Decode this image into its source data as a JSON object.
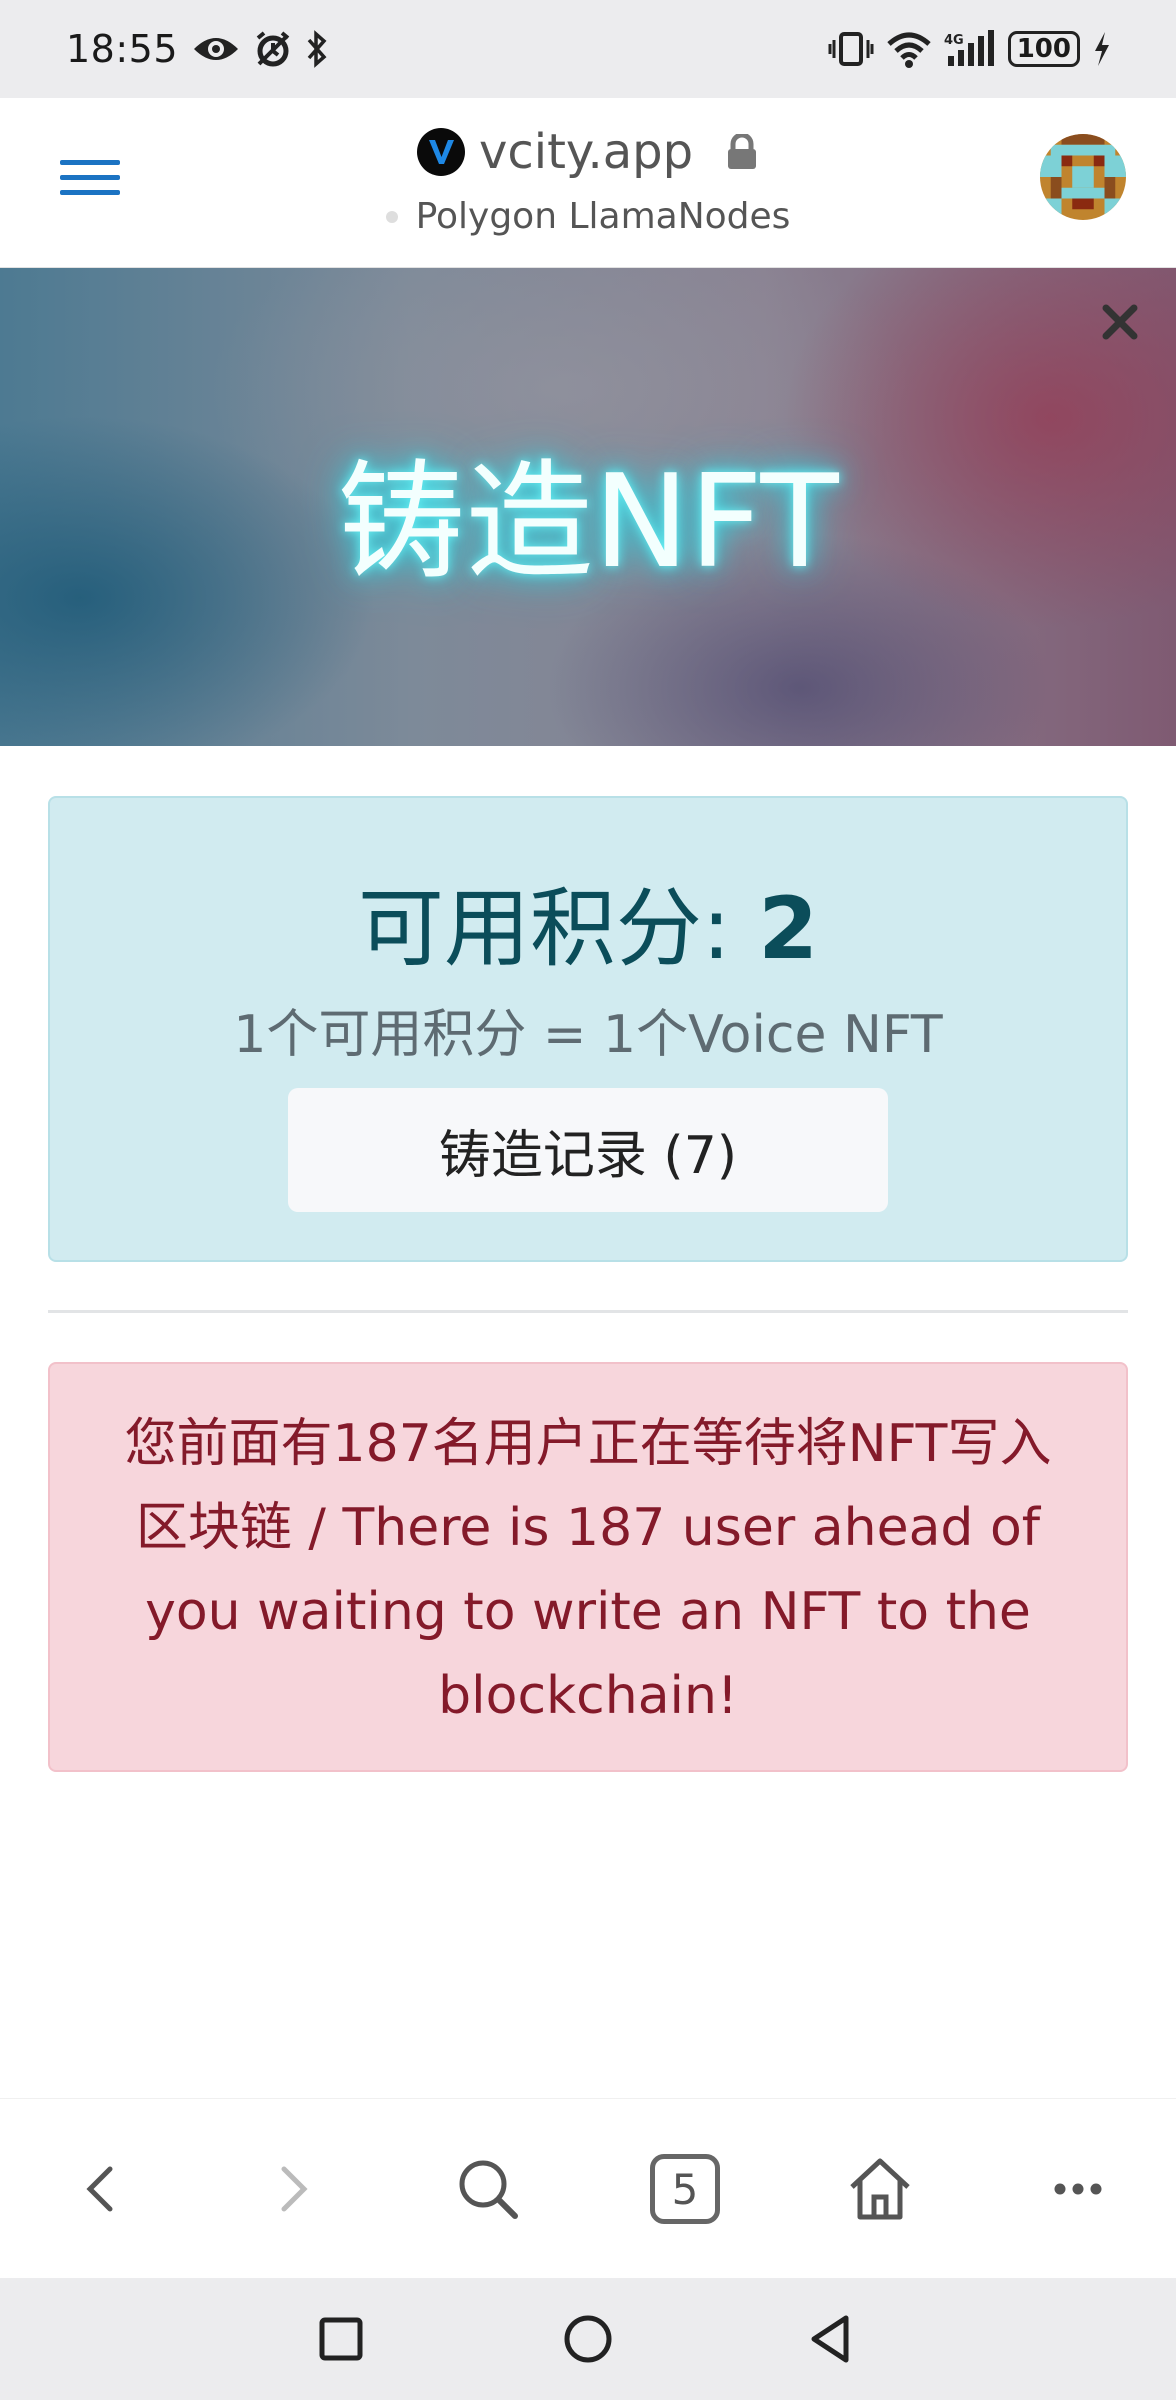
{
  "status_bar": {
    "time": "18:55",
    "battery": "100",
    "icons": [
      "eye-icon",
      "alarm-icon",
      "bluetooth-icon",
      "vibrate-icon",
      "wifi-icon",
      "signal-4g-icon",
      "charging-icon"
    ]
  },
  "browser": {
    "domain": "vcity.app",
    "network": "Polygon LlamaNodes",
    "brand_color": "#1b73c3"
  },
  "banner": {
    "title": "铸造NFT"
  },
  "credits": {
    "label": "可用积分: ",
    "value": "2",
    "rate": "1个可用积分 = 1个Voice NFT",
    "records_button": "铸造记录 (7)"
  },
  "alert": {
    "message": "您前面有187名用户正在等待将NFT写入区块链 / There is 187 user ahead of you waiting to write an NFT to the blockchain!"
  },
  "toolbar": {
    "tab_count": "5"
  }
}
